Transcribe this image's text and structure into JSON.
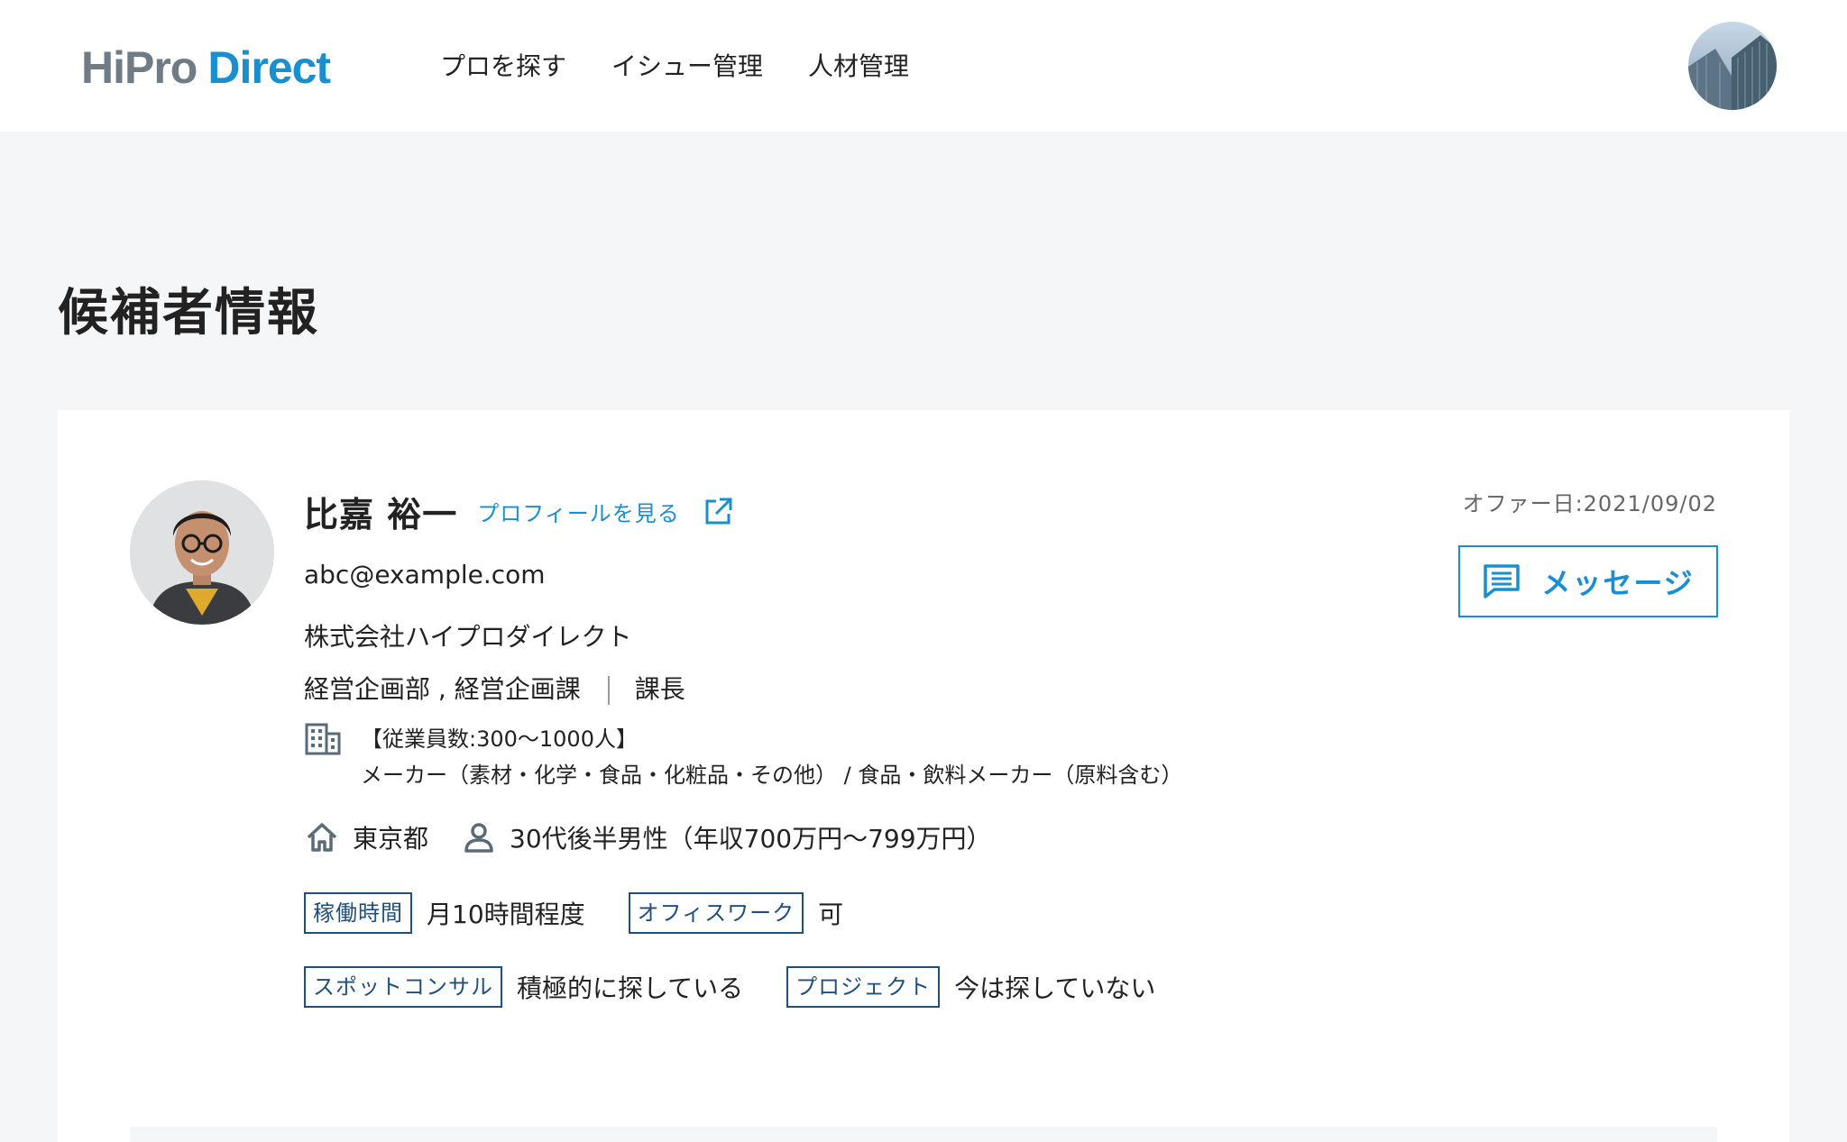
{
  "header": {
    "logo_hipro": "HiPro",
    "logo_direct": "Direct",
    "nav": [
      "プロを探す",
      "イシュー管理",
      "人材管理"
    ]
  },
  "page": {
    "title": "候補者情報"
  },
  "candidate": {
    "name": "比嘉 裕一",
    "profile_link": "プロフィールを見る",
    "email": "abc@example.com",
    "company": "株式会社ハイプロダイレクト",
    "department": "経営企画部 , 経営企画課",
    "position": "課長",
    "industry_size": "【従業員数:300〜1000人】",
    "industry_categories": "メーカー（素材・化学・食品・化粧品・その他） / 食品・飲料メーカー（原料含む）",
    "location": "東京都",
    "demographic": "30代後半男性（年収700万円〜799万円）",
    "offer_date": "オファー日:2021/09/02",
    "tags": [
      {
        "label": "稼働時間",
        "value": "月10時間程度"
      },
      {
        "label": "オフィスワーク",
        "value": "可"
      },
      {
        "label": "スポットコンサル",
        "value": "積極的に探している"
      },
      {
        "label": "プロジェクト",
        "value": "今は探していない"
      }
    ]
  },
  "actions": {
    "message_label": "メッセージ"
  },
  "icons": {
    "external": "external-link-icon",
    "building": "building-icon",
    "home": "home-icon",
    "person": "person-icon",
    "message": "message-icon"
  },
  "colors": {
    "accent": "#1a8fd0",
    "tag_border": "#1f4f7a",
    "background": "#f5f6f8"
  }
}
